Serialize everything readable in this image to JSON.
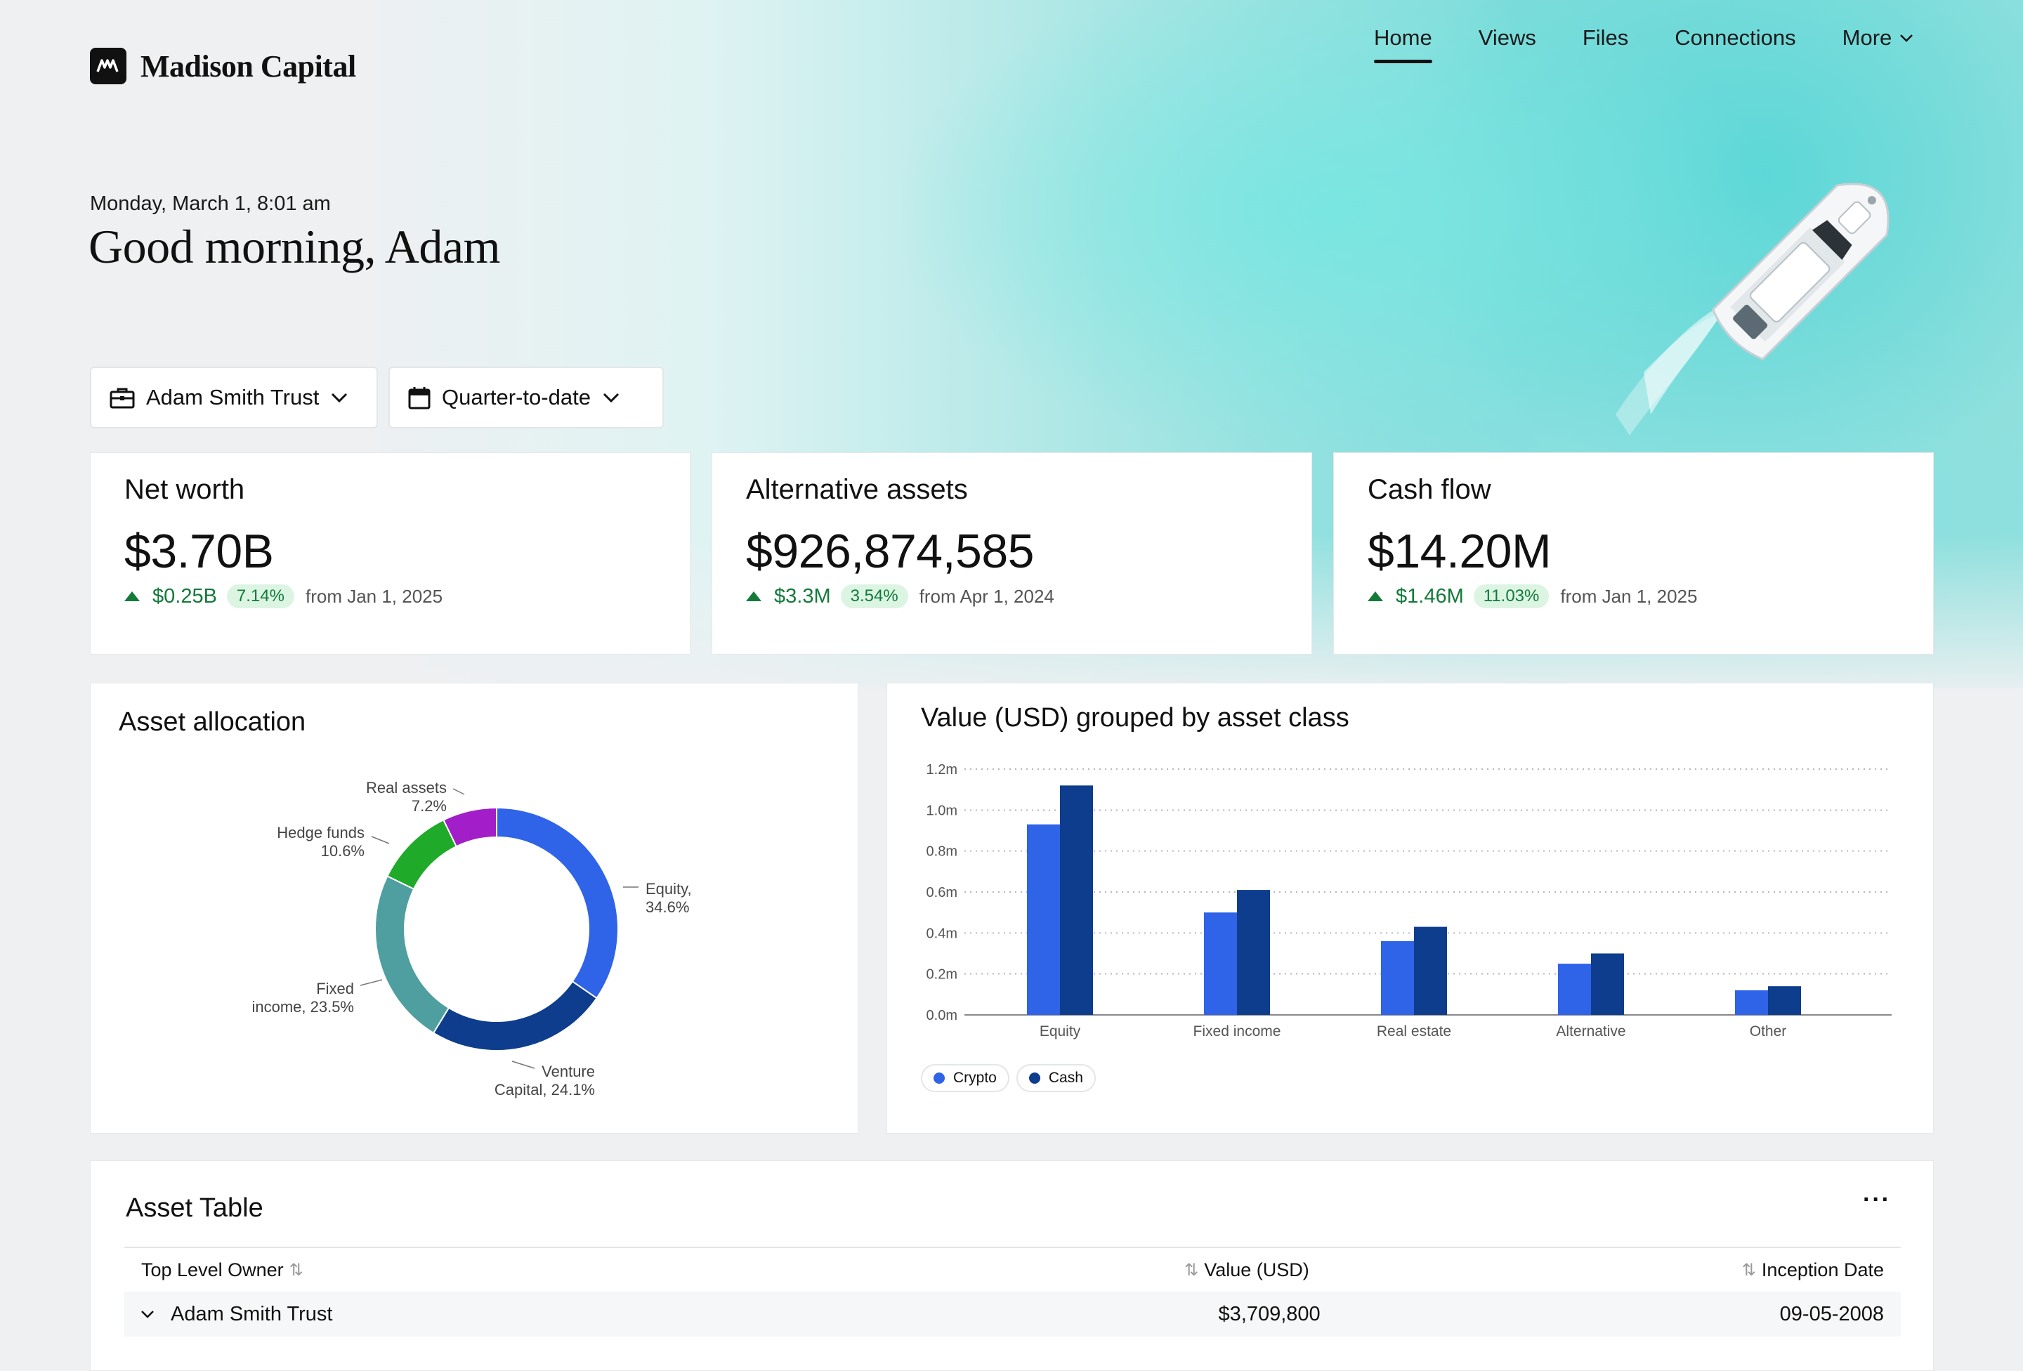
{
  "brand": {
    "name": "Madison Capital"
  },
  "nav": {
    "items": [
      {
        "label": "Home",
        "active": true
      },
      {
        "label": "Views",
        "active": false
      },
      {
        "label": "Files",
        "active": false
      },
      {
        "label": "Connections",
        "active": false
      },
      {
        "label": "More",
        "active": false
      }
    ]
  },
  "greeting": {
    "datetime": "Monday, March 1, 8:01 am",
    "message": "Good morning, Adam"
  },
  "filters": {
    "entity": {
      "label": "Adam Smith Trust",
      "icon": "briefcase-icon"
    },
    "period": {
      "label": "Quarter-to-date",
      "icon": "calendar-icon"
    }
  },
  "kpis": [
    {
      "title": "Net worth",
      "value": "$3.70B",
      "change": "$0.25B",
      "pct": "7.14%",
      "from": "from Jan 1, 2025",
      "direction": "up"
    },
    {
      "title": "Alternative assets",
      "value": "$926,874,585",
      "change": "$3.3M",
      "pct": "3.54%",
      "from": "from Apr 1, 2024",
      "direction": "up"
    },
    {
      "title": "Cash flow",
      "value": "$14.20M",
      "change": "$1.46M",
      "pct": "11.03%",
      "from": "from Jan 1, 2025",
      "direction": "up"
    }
  ],
  "colors": {
    "positive": "#137a3a",
    "positive_bg": "#dcf5e3",
    "crypto": "#2f63e8",
    "cash": "#0d3d8c"
  },
  "chart_data": [
    {
      "type": "pie",
      "title": "Asset allocation",
      "categories": [
        "Equity",
        "Venture Capital",
        "Fixed income",
        "Hedge funds",
        "Real assets"
      ],
      "values": [
        34.6,
        24.1,
        23.5,
        10.6,
        7.2
      ],
      "colors": [
        "#2f63e8",
        "#0d3d8c",
        "#4f9fa1",
        "#1faa2a",
        "#a21ec8"
      ],
      "labels": [
        [
          "Equity,",
          "34.6%"
        ],
        [
          "Venture",
          "Capital, 24.1%"
        ],
        [
          "Fixed",
          "income, 23.5%"
        ],
        [
          "Hedge funds",
          "10.6%"
        ],
        [
          "Real assets",
          "7.2%"
        ]
      ]
    },
    {
      "type": "bar",
      "title": "Value (USD) grouped by asset class",
      "categories": [
        "Equity",
        "Fixed income",
        "Real estate",
        "Alternative",
        "Other"
      ],
      "series": [
        {
          "name": "Crypto",
          "values": [
            0.93,
            0.5,
            0.36,
            0.25,
            0.12
          ]
        },
        {
          "name": "Cash",
          "values": [
            1.12,
            0.61,
            0.43,
            0.3,
            0.14
          ]
        }
      ],
      "ylim": [
        0,
        1.2
      ],
      "yticks": [
        "0.0m",
        "0.2m",
        "0.4m",
        "0.6m",
        "0.8m",
        "1.0m",
        "1.2m"
      ],
      "grid": true,
      "legend": "bottom-left"
    }
  ],
  "table": {
    "title": "Asset Table",
    "menu": "···",
    "columns": [
      "Top Level Owner",
      "Value (USD)",
      "Inception Date"
    ],
    "rows": [
      {
        "owner": "Adam Smith Trust",
        "value": "$3,709,800",
        "date": "09-05-2008"
      }
    ]
  }
}
